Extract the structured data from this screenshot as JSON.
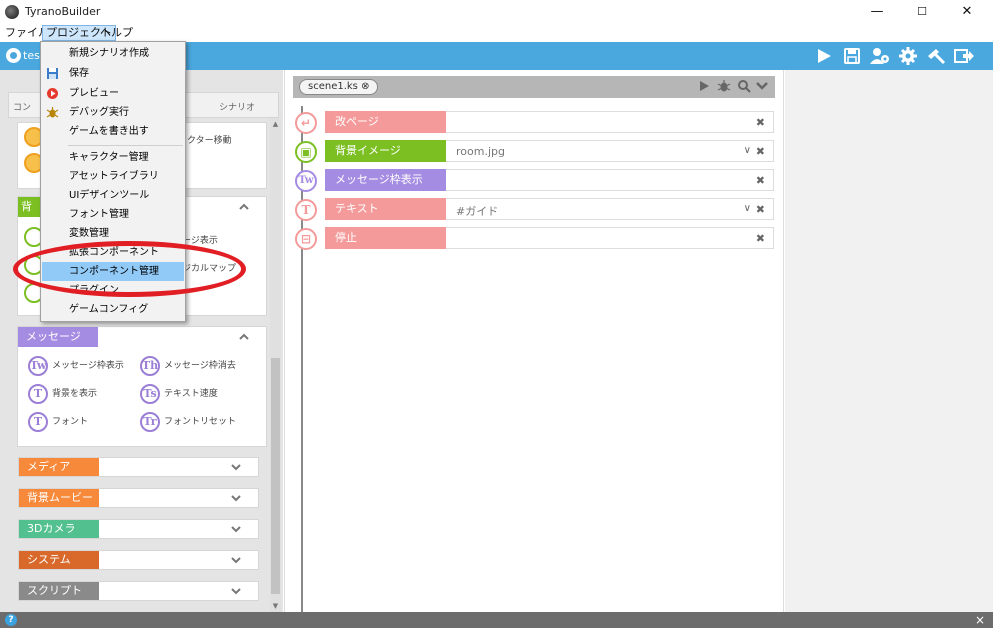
{
  "window": {
    "title": "TyranoBuilder",
    "minimize": "—",
    "maximize": "☐",
    "close": "✕"
  },
  "menubar": {
    "file": "ファイル",
    "project": "プロジェクト",
    "help": "ヘルプ"
  },
  "toolbar": {
    "project_name": "tes"
  },
  "left_panel": {
    "tabs": [
      "コン",
      "シナリオ"
    ],
    "peek": {
      "character_move": "ラクター移動",
      "message_show": "ージ表示",
      "map": "ジカルマップ",
      "bg_label": "背"
    },
    "message_card": {
      "label": "メッセージ",
      "items": [
        {
          "icon": "Tw",
          "label": "メッセージ枠表示"
        },
        {
          "icon": "Th",
          "label": "メッセージ枠消去"
        },
        {
          "icon": "T",
          "label": "背景を表示"
        },
        {
          "icon": "Ts",
          "label": "テキスト速度"
        },
        {
          "icon": "T",
          "label": "フォント"
        },
        {
          "icon": "Tr",
          "label": "フォントリセット"
        }
      ]
    },
    "collapsed_cards": [
      {
        "label": "メディア",
        "color": "#f7893b"
      },
      {
        "label": "背景ムービー",
        "color": "#f7893b"
      },
      {
        "label": "3Dカメラ",
        "color": "#52c08f"
      },
      {
        "label": "システム",
        "color": "#d8692a"
      },
      {
        "label": "スクリプト",
        "color": "#8a8a8a"
      }
    ]
  },
  "editor": {
    "file_tab": "scene1.ks ⊗",
    "rows": [
      {
        "label": "改ページ",
        "value": "",
        "color": "#f49a9a",
        "icon": "↵",
        "dropdown": false
      },
      {
        "label": "背景イメージ",
        "value": "room.jpg",
        "color": "#7bbf23",
        "icon": "▣",
        "dropdown": true
      },
      {
        "label": "メッセージ枠表示",
        "value": "",
        "color": "#a58ce3",
        "icon": "Tw",
        "dropdown": false
      },
      {
        "label": "テキスト",
        "value": "#ガイド",
        "color": "#f49a9a",
        "icon": "T",
        "dropdown": true
      },
      {
        "label": "停止",
        "value": "",
        "color": "#f49a9a",
        "icon": "⊟",
        "dropdown": false
      }
    ],
    "remove_symbol": "✖",
    "dropdown_symbol": "∨"
  },
  "project_menu": {
    "items": [
      "新規シナリオ作成",
      "保存",
      "プレビュー",
      "デバッグ実行",
      "ゲームを書き出す",
      "キャラクター管理",
      "アセットライブラリ",
      "UIデザインツール",
      "フォント管理",
      "変数管理",
      "拡張コンポーネント",
      "コンポーネント管理",
      "プラグイン",
      "ゲームコンフィグ"
    ],
    "highlighted": "コンポーネント管理"
  },
  "colors": {
    "toolbar": "#4aa8df",
    "highlight": "#91c9f7",
    "annotation": "#e01e24",
    "message": "#a58ce3"
  },
  "bottombar": {
    "help": "?",
    "close": "×"
  }
}
